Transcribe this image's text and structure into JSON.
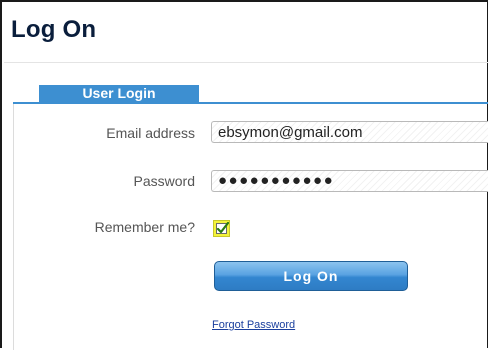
{
  "page": {
    "title": "Log On"
  },
  "panel": {
    "tab_label": "User Login"
  },
  "form": {
    "email": {
      "label": "Email address",
      "value": "ebsymon@gmail.com"
    },
    "password": {
      "label": "Password",
      "masked_value": "●●●●●●●●●●●"
    },
    "remember": {
      "label": "Remember me?",
      "checked": true
    },
    "submit_label": "Log On",
    "forgot_label": "Forgot Password"
  },
  "colors": {
    "accent": "#3d8fd1",
    "checkbox_highlight": "#f3f33a",
    "link": "#1a3f9e"
  },
  "icons": {
    "checkbox": "checkmark-icon"
  }
}
